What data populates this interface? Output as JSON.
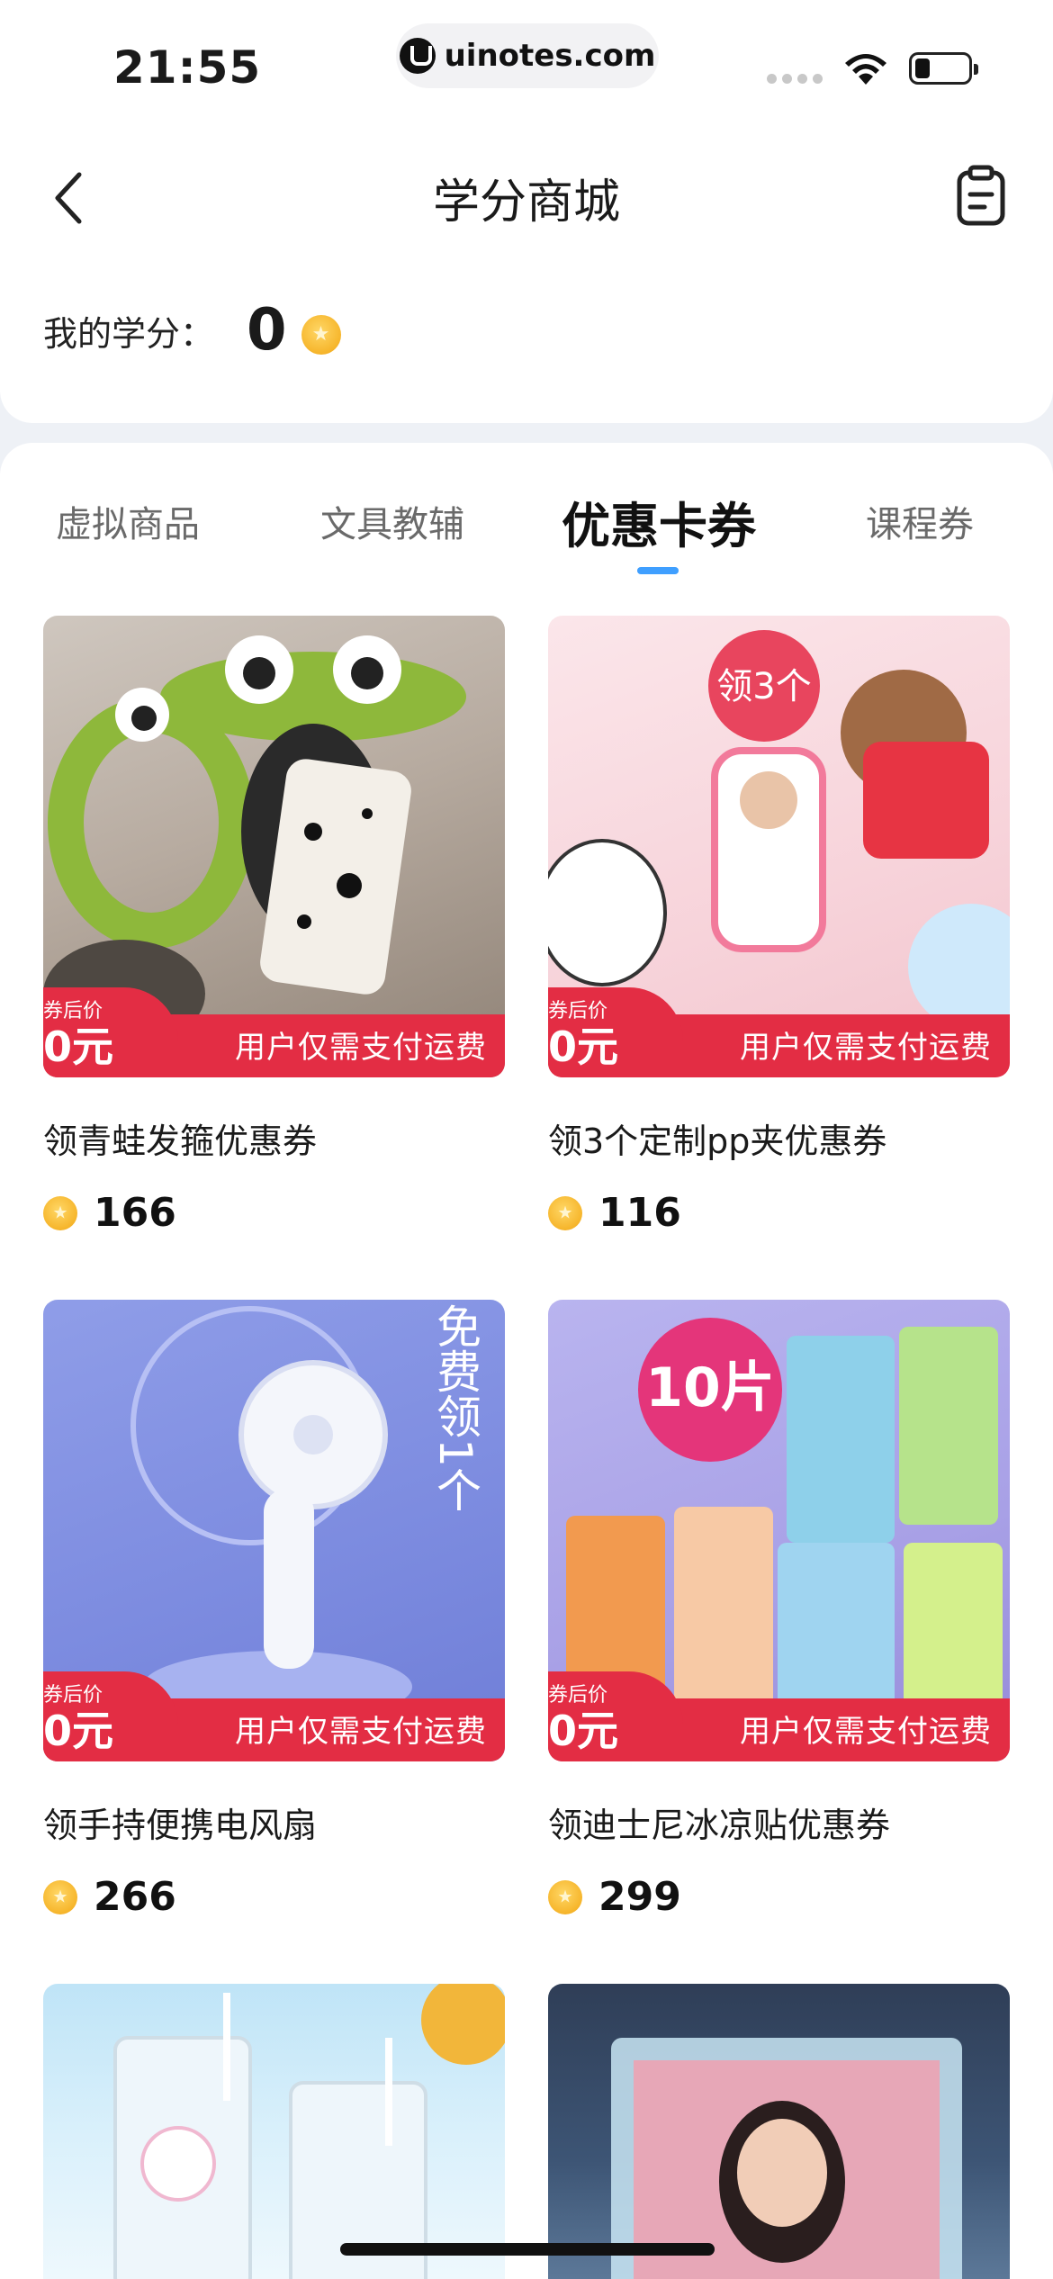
{
  "status_bar": {
    "time": "21:55",
    "url": "uinotes.com"
  },
  "header": {
    "title": "学分商城"
  },
  "credits": {
    "label": "我的学分：",
    "value": "0"
  },
  "tabs": [
    {
      "label": "虚拟商品",
      "active": false
    },
    {
      "label": "文具教辅",
      "active": false
    },
    {
      "label": "优惠卡券",
      "active": true
    },
    {
      "label": "课程券",
      "active": false
    }
  ],
  "promo": {
    "line1": "券后价",
    "line2": "0元",
    "text": "用户仅需支付运费"
  },
  "products": [
    {
      "title": "领青蛙发箍优惠券",
      "price": "166",
      "overlay": ""
    },
    {
      "title": "领3个定制pp夹优惠券",
      "price": "116",
      "overlay": "领3个"
    },
    {
      "title": "领手持便携电风扇",
      "price": "266",
      "overlay": "免费领1个"
    },
    {
      "title": "领迪士尼冰凉贴优惠券",
      "price": "299",
      "overlay": "10片"
    },
    {
      "title": "",
      "price": "",
      "overlay": ""
    },
    {
      "title": "",
      "price": "",
      "overlay": ""
    }
  ],
  "colors": {
    "accent": "#3f9fff",
    "promo_red": "#e32d44",
    "coin": "#f6b52b"
  }
}
